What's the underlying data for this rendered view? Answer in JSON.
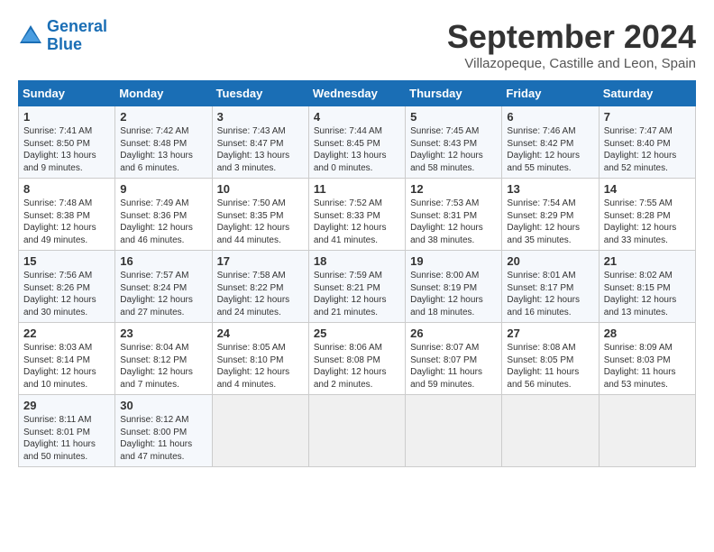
{
  "header": {
    "logo_line1": "General",
    "logo_line2": "Blue",
    "month": "September 2024",
    "location": "Villazopeque, Castille and Leon, Spain"
  },
  "weekdays": [
    "Sunday",
    "Monday",
    "Tuesday",
    "Wednesday",
    "Thursday",
    "Friday",
    "Saturday"
  ],
  "weeks": [
    [
      {
        "day": "1",
        "lines": [
          "Sunrise: 7:41 AM",
          "Sunset: 8:50 PM",
          "Daylight: 13 hours",
          "and 9 minutes."
        ]
      },
      {
        "day": "2",
        "lines": [
          "Sunrise: 7:42 AM",
          "Sunset: 8:48 PM",
          "Daylight: 13 hours",
          "and 6 minutes."
        ]
      },
      {
        "day": "3",
        "lines": [
          "Sunrise: 7:43 AM",
          "Sunset: 8:47 PM",
          "Daylight: 13 hours",
          "and 3 minutes."
        ]
      },
      {
        "day": "4",
        "lines": [
          "Sunrise: 7:44 AM",
          "Sunset: 8:45 PM",
          "Daylight: 13 hours",
          "and 0 minutes."
        ]
      },
      {
        "day": "5",
        "lines": [
          "Sunrise: 7:45 AM",
          "Sunset: 8:43 PM",
          "Daylight: 12 hours",
          "and 58 minutes."
        ]
      },
      {
        "day": "6",
        "lines": [
          "Sunrise: 7:46 AM",
          "Sunset: 8:42 PM",
          "Daylight: 12 hours",
          "and 55 minutes."
        ]
      },
      {
        "day": "7",
        "lines": [
          "Sunrise: 7:47 AM",
          "Sunset: 8:40 PM",
          "Daylight: 12 hours",
          "and 52 minutes."
        ]
      }
    ],
    [
      {
        "day": "8",
        "lines": [
          "Sunrise: 7:48 AM",
          "Sunset: 8:38 PM",
          "Daylight: 12 hours",
          "and 49 minutes."
        ]
      },
      {
        "day": "9",
        "lines": [
          "Sunrise: 7:49 AM",
          "Sunset: 8:36 PM",
          "Daylight: 12 hours",
          "and 46 minutes."
        ]
      },
      {
        "day": "10",
        "lines": [
          "Sunrise: 7:50 AM",
          "Sunset: 8:35 PM",
          "Daylight: 12 hours",
          "and 44 minutes."
        ]
      },
      {
        "day": "11",
        "lines": [
          "Sunrise: 7:52 AM",
          "Sunset: 8:33 PM",
          "Daylight: 12 hours",
          "and 41 minutes."
        ]
      },
      {
        "day": "12",
        "lines": [
          "Sunrise: 7:53 AM",
          "Sunset: 8:31 PM",
          "Daylight: 12 hours",
          "and 38 minutes."
        ]
      },
      {
        "day": "13",
        "lines": [
          "Sunrise: 7:54 AM",
          "Sunset: 8:29 PM",
          "Daylight: 12 hours",
          "and 35 minutes."
        ]
      },
      {
        "day": "14",
        "lines": [
          "Sunrise: 7:55 AM",
          "Sunset: 8:28 PM",
          "Daylight: 12 hours",
          "and 33 minutes."
        ]
      }
    ],
    [
      {
        "day": "15",
        "lines": [
          "Sunrise: 7:56 AM",
          "Sunset: 8:26 PM",
          "Daylight: 12 hours",
          "and 30 minutes."
        ]
      },
      {
        "day": "16",
        "lines": [
          "Sunrise: 7:57 AM",
          "Sunset: 8:24 PM",
          "Daylight: 12 hours",
          "and 27 minutes."
        ]
      },
      {
        "day": "17",
        "lines": [
          "Sunrise: 7:58 AM",
          "Sunset: 8:22 PM",
          "Daylight: 12 hours",
          "and 24 minutes."
        ]
      },
      {
        "day": "18",
        "lines": [
          "Sunrise: 7:59 AM",
          "Sunset: 8:21 PM",
          "Daylight: 12 hours",
          "and 21 minutes."
        ]
      },
      {
        "day": "19",
        "lines": [
          "Sunrise: 8:00 AM",
          "Sunset: 8:19 PM",
          "Daylight: 12 hours",
          "and 18 minutes."
        ]
      },
      {
        "day": "20",
        "lines": [
          "Sunrise: 8:01 AM",
          "Sunset: 8:17 PM",
          "Daylight: 12 hours",
          "and 16 minutes."
        ]
      },
      {
        "day": "21",
        "lines": [
          "Sunrise: 8:02 AM",
          "Sunset: 8:15 PM",
          "Daylight: 12 hours",
          "and 13 minutes."
        ]
      }
    ],
    [
      {
        "day": "22",
        "lines": [
          "Sunrise: 8:03 AM",
          "Sunset: 8:14 PM",
          "Daylight: 12 hours",
          "and 10 minutes."
        ]
      },
      {
        "day": "23",
        "lines": [
          "Sunrise: 8:04 AM",
          "Sunset: 8:12 PM",
          "Daylight: 12 hours",
          "and 7 minutes."
        ]
      },
      {
        "day": "24",
        "lines": [
          "Sunrise: 8:05 AM",
          "Sunset: 8:10 PM",
          "Daylight: 12 hours",
          "and 4 minutes."
        ]
      },
      {
        "day": "25",
        "lines": [
          "Sunrise: 8:06 AM",
          "Sunset: 8:08 PM",
          "Daylight: 12 hours",
          "and 2 minutes."
        ]
      },
      {
        "day": "26",
        "lines": [
          "Sunrise: 8:07 AM",
          "Sunset: 8:07 PM",
          "Daylight: 11 hours",
          "and 59 minutes."
        ]
      },
      {
        "day": "27",
        "lines": [
          "Sunrise: 8:08 AM",
          "Sunset: 8:05 PM",
          "Daylight: 11 hours",
          "and 56 minutes."
        ]
      },
      {
        "day": "28",
        "lines": [
          "Sunrise: 8:09 AM",
          "Sunset: 8:03 PM",
          "Daylight: 11 hours",
          "and 53 minutes."
        ]
      }
    ],
    [
      {
        "day": "29",
        "lines": [
          "Sunrise: 8:11 AM",
          "Sunset: 8:01 PM",
          "Daylight: 11 hours",
          "and 50 minutes."
        ]
      },
      {
        "day": "30",
        "lines": [
          "Sunrise: 8:12 AM",
          "Sunset: 8:00 PM",
          "Daylight: 11 hours",
          "and 47 minutes."
        ]
      },
      {
        "day": "",
        "lines": []
      },
      {
        "day": "",
        "lines": []
      },
      {
        "day": "",
        "lines": []
      },
      {
        "day": "",
        "lines": []
      },
      {
        "day": "",
        "lines": []
      }
    ]
  ]
}
